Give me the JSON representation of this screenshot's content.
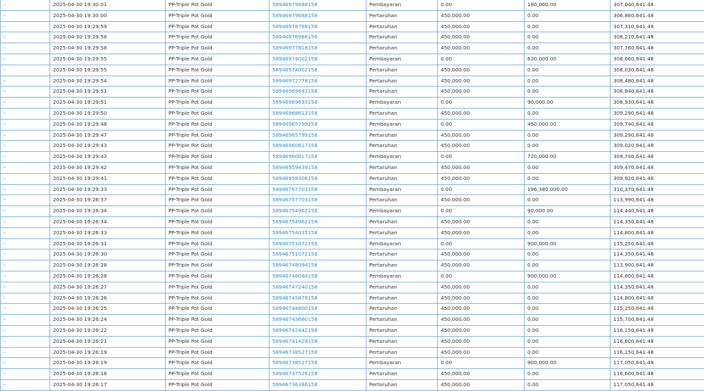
{
  "colors": {
    "border": "#7fb3dc",
    "link": "#2a8bd4",
    "text": "#333333"
  },
  "transactions": {
    "rows": [
      [
        "-",
        "2025-04-30 19:30:01",
        "PP-Triple Pot Gold",
        "58946979688158",
        "Pembayaran",
        "0.00",
        "180,000.00",
        "307,040,641.48"
      ],
      [
        "-",
        "2025-04-30 19:30:00",
        "PP-Triple Pot Gold",
        "58946979688158",
        "Pertaruhan",
        "450,000.00",
        "0.00",
        "306,860,641.48"
      ],
      [
        "-",
        "2025-04-30 19:29:59",
        "PP-Triple Pot Gold",
        "58946978769158",
        "Pertaruhan",
        "450,000.00",
        "0.00",
        "307,310,641.48"
      ],
      [
        "-",
        "2025-04-30 19:29:58",
        "PP-Triple Pot Gold",
        "58946976986158",
        "Pertaruhan",
        "450,000.00",
        "0.00",
        "308,210,641.48"
      ],
      [
        "-",
        "2025-04-30 19:29:58",
        "PP-Triple Pot Gold",
        "58946977818158",
        "Pertaruhan",
        "450,000.00",
        "0.00",
        "307,760,641.48"
      ],
      [
        "-",
        "2025-04-30 19:29:55",
        "PP-Triple Pot Gold",
        "58946974002158",
        "Pembayaran",
        "0.00",
        "630,000.00",
        "308,660,641.48"
      ],
      [
        "-",
        "2025-04-30 19:29:55",
        "PP-Triple Pot Gold",
        "58946974002158",
        "Pertaruhan",
        "450,000.00",
        "0.00",
        "308,030,641.48"
      ],
      [
        "-",
        "2025-04-30 19:29:54",
        "PP-Triple Pot Gold",
        "58946972778158",
        "Pertaruhan",
        "450,000.00",
        "0.00",
        "308,480,641.48"
      ],
      [
        "-",
        "2025-04-30 19:29:51",
        "PP-Triple Pot Gold",
        "58946969693158",
        "Pertaruhan",
        "450,000.00",
        "0.00",
        "308,840,641.48"
      ],
      [
        "-",
        "2025-04-30 19:29:51",
        "PP-Triple Pot Gold",
        "58946969693158",
        "Pembayaran",
        "0.00",
        "90,000.00",
        "308,930,641.48"
      ],
      [
        "-",
        "2025-04-30 19:29:50",
        "PP-Triple Pot Gold",
        "58946968613158",
        "Pertaruhan",
        "450,000.00",
        "0.00",
        "309,290,641.48"
      ],
      [
        "-",
        "2025-04-30 19:29:48",
        "PP-Triple Pot Gold",
        "58946965799158",
        "Pembayaran",
        "0.00",
        "450,000.00",
        "309,740,641.48"
      ],
      [
        "-",
        "2025-04-30 19:29:47",
        "PP-Triple Pot Gold",
        "58946965799158",
        "Pertaruhan",
        "450,000.00",
        "0.00",
        "309,290,641.48"
      ],
      [
        "-",
        "2025-04-30 19:29:43",
        "PP-Triple Pot Gold",
        "58946960617158",
        "Pertaruhan",
        "450,000.00",
        "0.00",
        "309,020,641.48"
      ],
      [
        "-",
        "2025-04-30 19:29:43",
        "PP-Triple Pot Gold",
        "58946960617158",
        "Pembayaran",
        "0.00",
        "720,000.00",
        "309,740,641.48"
      ],
      [
        "-",
        "2025-04-30 19:29:42",
        "PP-Triple Pot Gold",
        "58946959439158",
        "Pertaruhan",
        "450,000.00",
        "0.00",
        "309,470,641.48"
      ],
      [
        "-",
        "2025-04-30 19:29:41",
        "PP-Triple Pot Gold",
        "58946958306158",
        "Pertaruhan",
        "450,000.00",
        "0.00",
        "309,920,641.48"
      ],
      [
        "-",
        "2025-04-30 19:29:33",
        "PP-Triple Pot Gold",
        "58946757703158",
        "Pembayaran",
        "0.00",
        "196,380,000.00",
        "310,370,641.48"
      ],
      [
        "-",
        "2025-04-30 19:26:37",
        "PP-Triple Pot Gold",
        "58946757703158",
        "Pertaruhan",
        "450,000.00",
        "0.00",
        "113,990,641.48"
      ],
      [
        "-",
        "2025-04-30 19:26:34",
        "PP-Triple Pot Gold",
        "58946754962158",
        "Pembayaran",
        "0.00",
        "90,000.00",
        "114,440,641.48"
      ],
      [
        "-",
        "2025-04-30 19:26:34",
        "PP-Triple Pot Gold",
        "58946754962158",
        "Pertaruhan",
        "450,000.00",
        "0.00",
        "114,350,641.48"
      ],
      [
        "-",
        "2025-04-30 19:26:33",
        "PP-Triple Pot Gold",
        "58946754035158",
        "Pertaruhan",
        "450,000.00",
        "0.00",
        "114,800,641.48"
      ],
      [
        "-",
        "2025-04-30 19:26:31",
        "PP-Triple Pot Gold",
        "58946751072158",
        "Pembayaran",
        "0.00",
        "900,000.00",
        "115,250,641.48"
      ],
      [
        "-",
        "2025-04-30 19:26:30",
        "PP-Triple Pot Gold",
        "58946751072158",
        "Pertaruhan",
        "450,000.00",
        "0.00",
        "114,350,641.48"
      ],
      [
        "-",
        "2025-04-30 19:26:28",
        "PP-Triple Pot Gold",
        "58946748094158",
        "Pertaruhan",
        "450,000.00",
        "0.00",
        "113,900,641.48"
      ],
      [
        "-",
        "2025-04-30 19:26:28",
        "PP-Triple Pot Gold",
        "58946748094158",
        "Pembayaran",
        "0.00",
        "900,000.00",
        "114,800,641.48"
      ],
      [
        "-",
        "2025-04-30 19:26:27",
        "PP-Triple Pot Gold",
        "58946747240158",
        "Pertaruhan",
        "450,000.00",
        "0.00",
        "114,350,641.48"
      ],
      [
        "-",
        "2025-04-30 19:26:26",
        "PP-Triple Pot Gold",
        "58946745879158",
        "Pertaruhan",
        "450,000.00",
        "0.00",
        "114,800,641.48"
      ],
      [
        "-",
        "2025-04-30 19:26:25",
        "PP-Triple Pot Gold",
        "58946744800158",
        "Pertaruhan",
        "450,000.00",
        "0.00",
        "115,250,641.48"
      ],
      [
        "-",
        "2025-04-30 19:26:24",
        "PP-Triple Pot Gold",
        "58946743660158",
        "Pertaruhan",
        "450,000.00",
        "0.00",
        "115,700,641.48"
      ],
      [
        "-",
        "2025-04-30 19:26:22",
        "PP-Triple Pot Gold",
        "58946742442158",
        "Pertaruhan",
        "450,000.00",
        "0.00",
        "116,150,641.48"
      ],
      [
        "-",
        "2025-04-30 19:26:21",
        "PP-Triple Pot Gold",
        "58946741429158",
        "Pertaruhan",
        "450,000.00",
        "0.00",
        "116,600,641.48"
      ],
      [
        "-",
        "2025-04-30 19:26:19",
        "PP-Triple Pot Gold",
        "58946738527158",
        "Pertaruhan",
        "450,000.00",
        "0.00",
        "116,150,641.48"
      ],
      [
        "-",
        "2025-04-30 19:26:19",
        "PP-Triple Pot Gold",
        "58946738527158",
        "Pembayaran",
        "0.00",
        "900,000.00",
        "117,050,641.48"
      ],
      [
        "-",
        "2025-04-30 19:26:18",
        "PP-Triple Pot Gold",
        "58946737526158",
        "Pertaruhan",
        "450,000.00",
        "0.00",
        "116,600,641.48"
      ],
      [
        "-",
        "2025-04-30 19:26:17",
        "PP-Triple Pot Gold",
        "58946736386158",
        "Pertaruhan",
        "450,000.00",
        "0.00",
        "117,050,641.48"
      ]
    ]
  }
}
